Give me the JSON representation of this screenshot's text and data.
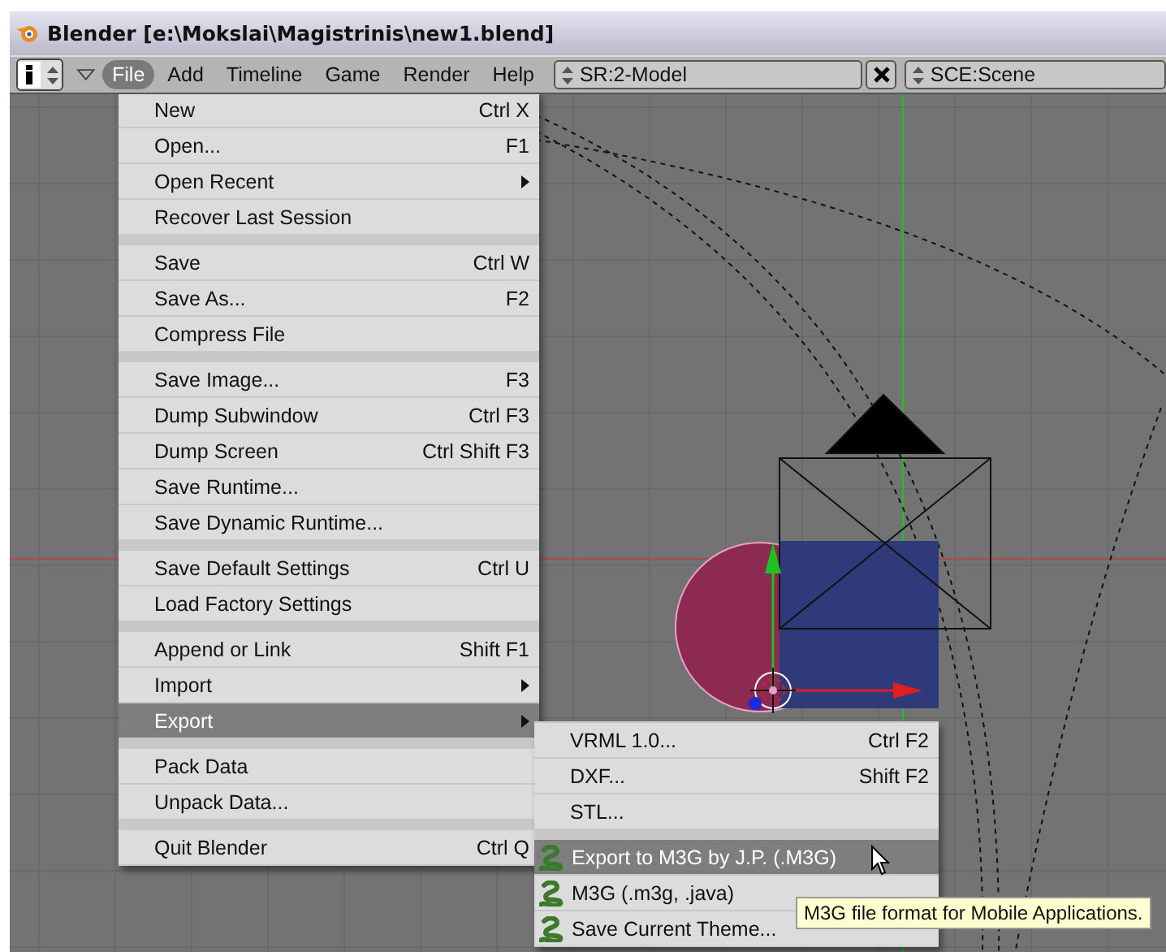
{
  "window": {
    "title": "Blender [e:\\Mokslai\\Magistrinis\\new1.blend]"
  },
  "header": {
    "menus": [
      {
        "label": "File",
        "selected": true
      },
      {
        "label": "Add",
        "selected": false
      },
      {
        "label": "Timeline",
        "selected": false
      },
      {
        "label": "Game",
        "selected": false
      },
      {
        "label": "Render",
        "selected": false
      },
      {
        "label": "Help",
        "selected": false
      }
    ],
    "screen_field": {
      "value": "SR:2-Model"
    },
    "scene_field": {
      "value": "SCE:Scene"
    }
  },
  "file_menu": {
    "sections": [
      [
        {
          "label": "New",
          "shortcut": "Ctrl X",
          "submenu": false,
          "selected": false
        },
        {
          "label": "Open...",
          "shortcut": "F1",
          "submenu": false,
          "selected": false
        },
        {
          "label": "Open Recent",
          "submenu": true,
          "selected": false
        },
        {
          "label": "Recover Last Session",
          "submenu": false,
          "selected": false
        }
      ],
      [
        {
          "label": "Save",
          "shortcut": "Ctrl W",
          "submenu": false,
          "selected": false
        },
        {
          "label": "Save As...",
          "shortcut": "F2",
          "submenu": false,
          "selected": false
        },
        {
          "label": "Compress File",
          "submenu": false,
          "selected": false
        }
      ],
      [
        {
          "label": "Save Image...",
          "shortcut": "F3",
          "submenu": false,
          "selected": false
        },
        {
          "label": "Dump Subwindow",
          "shortcut": "Ctrl F3",
          "submenu": false,
          "selected": false
        },
        {
          "label": "Dump Screen",
          "shortcut": "Ctrl Shift F3",
          "submenu": false,
          "selected": false
        },
        {
          "label": "Save Runtime...",
          "submenu": false,
          "selected": false
        },
        {
          "label": "Save Dynamic Runtime...",
          "submenu": false,
          "selected": false
        }
      ],
      [
        {
          "label": "Save Default Settings",
          "shortcut": "Ctrl U",
          "submenu": false,
          "selected": false
        },
        {
          "label": "Load Factory Settings",
          "submenu": false,
          "selected": false
        }
      ],
      [
        {
          "label": "Append or Link",
          "shortcut": "Shift F1",
          "submenu": false,
          "selected": false
        },
        {
          "label": "Import",
          "submenu": true,
          "selected": false
        },
        {
          "label": "Export",
          "submenu": true,
          "selected": true
        }
      ],
      [
        {
          "label": "Pack Data",
          "submenu": false,
          "selected": false
        },
        {
          "label": "Unpack Data...",
          "submenu": false,
          "selected": false
        }
      ],
      [
        {
          "label": "Quit Blender",
          "shortcut": "Ctrl Q",
          "submenu": false,
          "selected": false
        }
      ]
    ]
  },
  "export_menu": {
    "sections": [
      [
        {
          "kind": "plain",
          "label": "VRML 1.0...",
          "shortcut": "Ctrl F2",
          "selected": false
        },
        {
          "kind": "plain",
          "label": "DXF...",
          "shortcut": "Shift F2",
          "selected": false
        },
        {
          "kind": "plain",
          "label": "STL...",
          "selected": false
        }
      ],
      [
        {
          "kind": "script",
          "label": "Export to M3G by J.P. (.M3G)",
          "selected": true
        },
        {
          "kind": "script",
          "label": "M3G (.m3g, .java)",
          "selected": false
        },
        {
          "kind": "script",
          "label": "Save Current Theme...",
          "selected": false
        }
      ]
    ]
  },
  "tooltip": {
    "text": "M3G file format for Mobile Applications."
  }
}
